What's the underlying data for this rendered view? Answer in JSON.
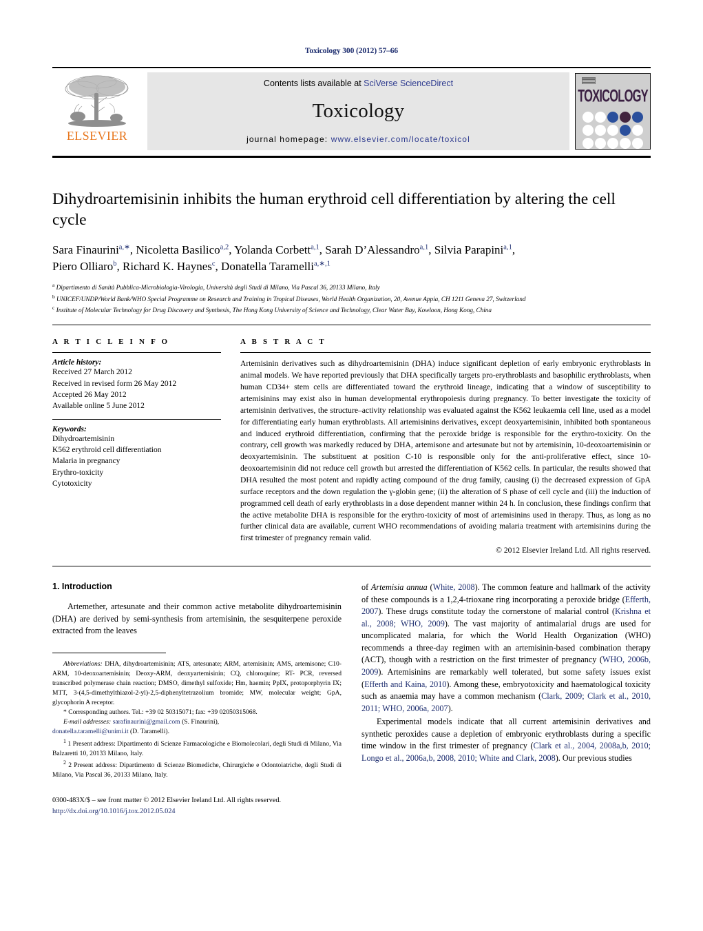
{
  "running_head": "Toxicology 300 (2012) 57–66",
  "masthead": {
    "publisher_name": "ELSEVIER",
    "contents_prefix": "Contents lists available at ",
    "contents_link": "SciVerse ScienceDirect",
    "journal_title": "Toxicology",
    "homepage_prefix": "journal homepage: ",
    "homepage_link": "www.elsevier.com/locate/toxicol",
    "cover_word": "TOXICOLOGY",
    "link_color": "#2e3b8f"
  },
  "article": {
    "title": "Dihydroartemisinin inhibits the human erythroid cell differentiation by altering the cell cycle",
    "authors_line_1": "Sara Finaurini<sup>a,∗</sup>, Nicoletta Basilico<sup>a,2</sup>, Yolanda Corbett<sup>a,1</sup>, Sarah D’Alessandro<sup>a,1</sup>, Silvia Parapini<sup>a,1</sup>,",
    "authors_line_2": "Piero Olliaro<sup>b</sup>, Richard K. Haynes<sup>c</sup>, Donatella Taramelli<sup>a,∗,1</sup>",
    "affiliations": [
      "<sup>a</sup> Dipartimento di Sanità Pubblica-Microbiologia-Virologia, Università degli Studi di Milano, Via Pascal 36, 20133 Milano, Italy",
      "<sup>b</sup> UNICEF/UNDP/World Bank/WHO Special Programme on Research and Training in Tropical Diseases, World Health Organization, 20, Avenue Appia, CH 1211 Geneva 27, Switzerland",
      "<sup>c</sup> Institute of Molecular Technology for Drug Discovery and Synthesis, The Hong Kong University of Science and Technology, Clear Water Bay, Kowloon, Hong Kong, China"
    ]
  },
  "article_info": {
    "heading": "A R T I C L E   I N F O",
    "history_label": "Article history:",
    "history": [
      "Received 27 March 2012",
      "Received in revised form 26 May 2012",
      "Accepted 26 May 2012",
      "Available online 5 June 2012"
    ],
    "keywords_label": "Keywords:",
    "keywords": [
      "Dihydroartemisinin",
      "K562 erythroid cell differentiation",
      "Malaria in pregnancy",
      "Erythro-toxicity",
      "Cytotoxicity"
    ]
  },
  "abstract": {
    "heading": "A B S T R A C T",
    "text": "Artemisinin derivatives such as dihydroartemisinin (DHA) induce significant depletion of early embryonic erythroblasts in animal models. We have reported previously that DHA specifically targets pro-erythroblasts and basophilic erythroblasts, when human CD34+ stem cells are differentiated toward the erythroid lineage, indicating that a window of susceptibility to artemisinins may exist also in human developmental erythropoiesis during pregnancy. To better investigate the toxicity of artemisinin derivatives, the structure–activity relationship was evaluated against the K562 leukaemia cell line, used as a model for differentiating early human erythroblasts. All artemisinins derivatives, except deoxyartemisinin, inhibited both spontaneous and induced erythroid differentiation, confirming that the peroxide bridge is responsible for the erythro-toxicity. On the contrary, cell growth was markedly reduced by DHA, artemisone and artesunate but not by artemisinin, 10-deoxoartemisinin or deoxyartemisinin. The substituent at position C-10 is responsible only for the anti-proliferative effect, since 10-deoxoartemisinin did not reduce cell growth but arrested the differentiation of K562 cells. In particular, the results showed that DHA resulted the most potent and rapidly acting compound of the drug family, causing (i) the decreased expression of GpA surface receptors and the down regulation the γ-globin gene; (ii) the alteration of S phase of cell cycle and (iii) the induction of programmed cell death of early erythroblasts in a dose dependent manner within 24 h. In conclusion, these findings confirm that the active metabolite DHA is responsible for the erythro-toxicity of most of artemisinins used in therapy. Thus, as long as no further clinical data are available, current WHO recommendations of avoiding malaria treatment with artemisinins during the first trimester of pregnancy remain valid.",
    "copyright": "© 2012 Elsevier Ireland Ltd. All rights reserved."
  },
  "introduction": {
    "section_number_title": "1.  Introduction",
    "left_paragraph": "Artemether, artesunate and their common active metabolite dihydroartemisinin (DHA) are derived by semi-synthesis from artemisinin, the sesquiterpene peroxide extracted from the leaves",
    "right_continuation_pre": "of ",
    "right_continuation_italic": "Artemisia annua",
    "right_continuation_post": " (White, 2008). The common feature and hallmark of the activity of these compounds is a 1,2,4-trioxane ring incorporating a peroxide bridge (Efferth, 2007). These drugs constitute today the cornerstone of malarial control (Krishna et al., 2008; WHO, 2009). The vast majority of antimalarial drugs are used for uncomplicated malaria, for which the World Health Organization (WHO) recommends a three-day regimen with an artemisinin-based combination therapy (ACT), though with a restriction on the first trimester of pregnancy (WHO, 2006b, 2009). Artemisinins are remarkably well tolerated, but some safety issues exist (Efferth and Kaina, 2010). Among these, embryotoxicity and haematological toxicity such as anaemia may have a common mechanism (Clark, 2009; Clark et al., 2010, 2011; WHO, 2006a, 2007).",
    "right_paragraph_2": "Experimental models indicate that all current artemisinin derivatives and synthetic peroxides cause a depletion of embryonic erythroblasts during a specific time window in the first trimester of pregnancy (Clark et al., 2004, 2008a,b, 2010; Longo et al., 2006a,b, 2008, 2010; White and Clark, 2008). Our previous studies"
  },
  "footnotes": {
    "abbreviations_label": "Abbreviations:",
    "abbreviations_text": " DHA, dihydroartemisinin; ATS, artesunate; ARM, artemisinin; AMS, artemisone; C10-ARM, 10-deoxoartemisinin; Deoxy-ARM, deoxyartemisinin; CQ, chloroquine; RT- PCR, reversed transcribed polymerase chain reaction; DMSO, dimethyl sulfoxide; Hm, haemin; PpIX, protoporphyrin IX; MTT, 3-(4,5-dimethylthiazol-2-yl)-2,5-diphenyltetrazolium bromide; MW, molecular weight; GpA, glycophorin A receptor.",
    "corresponding": "* Corresponding authors. Tel.: +39 02 50315071; fax: +39 02050315068.",
    "email_label": "E-mail addresses:",
    "email_1": "sarafinaurini@gmail.com",
    "email_1_owner": " (S. Finaurini),",
    "email_2": "donatella.taramelli@unimi.it",
    "email_2_owner": " (D. Taramelli).",
    "present_address_1": "1 Present address: Dipartimento di Scienze Farmacologiche e Biomolecolari, degli Studi di Milano, Via Balzaretti 10, 20133 Milano, Italy.",
    "present_address_2": "2 Present address: Dipartimento di Scienze Biomediche, Chirurgiche e Odontoiatriche, degli Studi di Milano, Via Pascal 36, 20133 Milano, Italy."
  },
  "footer": {
    "issn_line": "0300-483X/$ – see front matter © 2012 Elsevier Ireland Ltd. All rights reserved.",
    "doi": "http://dx.doi.org/10.1016/j.tox.2012.05.024"
  }
}
